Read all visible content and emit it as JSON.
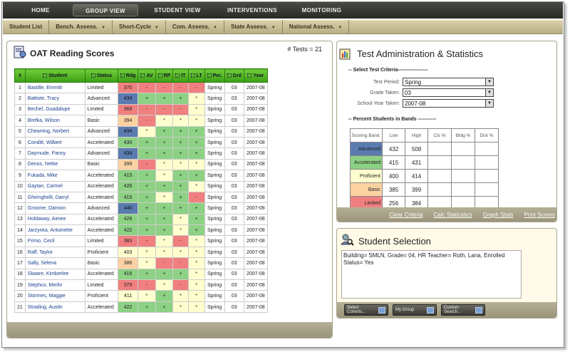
{
  "nav": {
    "top": [
      "HOME",
      "GROUP VIEW",
      "STUDENT VIEW",
      "INTERVENTIONS",
      "MONITORING"
    ],
    "active": "GROUP VIEW",
    "sub": [
      "Student List",
      "Bench. Assess.",
      "Short-Cycle",
      "Com. Assess.",
      "State Assess.",
      "National Assess."
    ]
  },
  "scores": {
    "title": "OAT Reading Scores",
    "tests_count": "# Tests = 21",
    "columns": [
      "#",
      "Student",
      "Status",
      "Rdg",
      "AV",
      "RP",
      "IT",
      "LT",
      "Per.",
      "Grd",
      "Year"
    ],
    "rows": [
      [
        "1",
        "Bastille, Emmitt",
        "Limited",
        "370",
        "-",
        "-",
        "-",
        "-",
        "Spring",
        "03",
        "2007-08"
      ],
      [
        "2",
        "Battiste, Tracy",
        "Advanced",
        "434",
        "+",
        "+",
        "+",
        "*",
        "Spring",
        "03",
        "2007-08"
      ],
      [
        "3",
        "Bechel, Guadalupe",
        "Limited",
        "368",
        "-",
        "-",
        "-",
        "*",
        "Spring",
        "03",
        "2007-08"
      ],
      [
        "4",
        "Brefka, Wilson",
        "Basic",
        "394",
        "-",
        "*",
        "*",
        "*",
        "Spring",
        "03",
        "2007-08"
      ],
      [
        "5",
        "Chewning, Norbert",
        "Advanced",
        "434",
        "*",
        "+",
        "+",
        "+",
        "Spring",
        "03",
        "2007-08"
      ],
      [
        "6",
        "Conditt, Wilbert",
        "Accelerated",
        "430",
        "+",
        "+",
        "+",
        "+",
        "Spring",
        "03",
        "2007-08"
      ],
      [
        "7",
        "Daymude, Pansy",
        "Advanced",
        "434",
        "+",
        "+",
        "+",
        "+",
        "Spring",
        "03",
        "2007-08"
      ],
      [
        "8",
        "Denos, Nettie",
        "Basic",
        "399",
        "-",
        "*",
        "*",
        "*",
        "Spring",
        "03",
        "2007-08"
      ],
      [
        "9",
        "Fukada, Mike",
        "Accelerated",
        "415",
        "+",
        "*",
        "+",
        "+",
        "Spring",
        "03",
        "2007-08"
      ],
      [
        "10",
        "Gaytan, Carmel",
        "Accelerated",
        "426",
        "+",
        "+",
        "+",
        "*",
        "Spring",
        "03",
        "2007-08"
      ],
      [
        "11",
        "Ghiringhelli, Darryl",
        "Accelerated",
        "415",
        "+",
        "*",
        "+",
        "-",
        "Spring",
        "03",
        "2007-08"
      ],
      [
        "12",
        "Groome, Damion",
        "Advanced",
        "440",
        "+",
        "+",
        "+",
        "+",
        "Spring",
        "03",
        "2007-08"
      ],
      [
        "13",
        "Holdaway, Aimee",
        "Accelerated",
        "426",
        "+",
        "+",
        "*",
        "+",
        "Spring",
        "03",
        "2007-08"
      ],
      [
        "14",
        "Jarzynka, Antoinette",
        "Accelerated",
        "422",
        "+",
        "+",
        "*",
        "+",
        "Spring",
        "03",
        "2007-08"
      ],
      [
        "15",
        "Primo, Cecil",
        "Limited",
        "383",
        "-",
        "*",
        "-",
        "*",
        "Spring",
        "03",
        "2007-08"
      ],
      [
        "16",
        "Raff, Taylor",
        "Proficient",
        "403",
        "*",
        "*",
        "*",
        "*",
        "Spring",
        "03",
        "2007-08"
      ],
      [
        "17",
        "Sally, Selena",
        "Basic",
        "386",
        "*",
        "-",
        "-",
        "*",
        "Spring",
        "03",
        "2007-08"
      ],
      [
        "18",
        "Skaare, Kimberlee",
        "Accelerated",
        "416",
        "+",
        "+",
        "+",
        "*",
        "Spring",
        "03",
        "2007-08"
      ],
      [
        "19",
        "Stephco, Merlin",
        "Limited",
        "379",
        "-",
        "*",
        "-",
        "*",
        "Spring",
        "03",
        "2007-08"
      ],
      [
        "20",
        "Stormes, Maggie",
        "Proficient",
        "411",
        "*",
        "+",
        "*",
        "*",
        "Spring",
        "03",
        "2007-08"
      ],
      [
        "21",
        "Strading, Austin",
        "Accelerated",
        "422",
        "+",
        "+",
        "*",
        "*",
        "Spring",
        "03",
        "2007-08"
      ]
    ]
  },
  "stats": {
    "title": "Test Administration & Statistics",
    "criteria_header": "-- Select Test Criteria------------------",
    "fields": [
      {
        "label": "Test Period:",
        "value": "Spring"
      },
      {
        "label": "Grade Taken:",
        "value": "03"
      },
      {
        "label": "School Year Taken:",
        "value": "2007-08"
      }
    ],
    "bands_header": "-- Percent Students in Bands -----------",
    "bands_columns": [
      "Scoring Band",
      "Low",
      "High",
      "Cls %",
      "Bldg %",
      "Dist %"
    ],
    "bands": [
      {
        "name": "Advanced",
        "low": "432",
        "high": "508"
      },
      {
        "name": "Accelerated",
        "low": "415",
        "high": "431"
      },
      {
        "name": "Proficient",
        "low": "400",
        "high": "414"
      },
      {
        "name": "Basic",
        "low": "385",
        "high": "399"
      },
      {
        "name": "Limited",
        "low": "256",
        "high": "384"
      }
    ],
    "links": [
      "Clear Criteria",
      "Calc Staticstics",
      "Graph Stats",
      "Print Scores"
    ]
  },
  "selection": {
    "title": "Student Selection",
    "text": "Building= SMLN, Grade= 04, HR Teacher= Roth, Lana, Enrolled Status= Yes",
    "buttons": [
      "Select Cohorts...",
      "My Group",
      "Custom Search..."
    ]
  },
  "colors": {
    "Advanced": "#5b7bb0",
    "Accelerated": "#8dd184",
    "Proficient": "#fefecf",
    "Basic": "#fcd2a3",
    "Limited": "#f08080"
  }
}
